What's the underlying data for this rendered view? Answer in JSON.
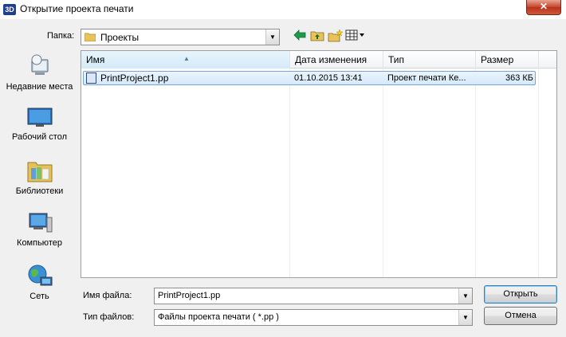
{
  "window": {
    "app_icon_text": "3D",
    "title": "Открытие проекта печати",
    "close_glyph": "✕"
  },
  "address": {
    "label": "Папка:",
    "folder": "Проекты"
  },
  "toolbar": {
    "icons": [
      "back-arrow-icon",
      "up-folder-icon",
      "new-folder-icon",
      "view-menu-icon"
    ]
  },
  "places": [
    {
      "label": "Недавние места",
      "icon": "recent-places-icon"
    },
    {
      "label": "Рабочий стол",
      "icon": "desktop-icon"
    },
    {
      "label": "Библиотеки",
      "icon": "libraries-icon"
    },
    {
      "label": "Компьютер",
      "icon": "computer-icon"
    },
    {
      "label": "Сеть",
      "icon": "network-icon"
    }
  ],
  "columns": {
    "name": "Имя",
    "date": "Дата изменения",
    "type": "Тип",
    "size": "Размер"
  },
  "files": [
    {
      "name": "PrintProject1.pp",
      "date": "01.10.2015 13:41",
      "type": "Проект печати Ке...",
      "size": "363 КБ"
    }
  ],
  "form": {
    "filename_label": "Имя файла:",
    "filename_value": "PrintProject1.pp",
    "filetype_label": "Тип файлов:",
    "filetype_value": "Файлы проекта печати ( *.pp )",
    "open_button": "Открыть",
    "cancel_button": "Отмена"
  },
  "colors": {
    "selection": "#d5e9fb",
    "selection_border": "#7da2ce",
    "close_button": "#c7432a"
  }
}
